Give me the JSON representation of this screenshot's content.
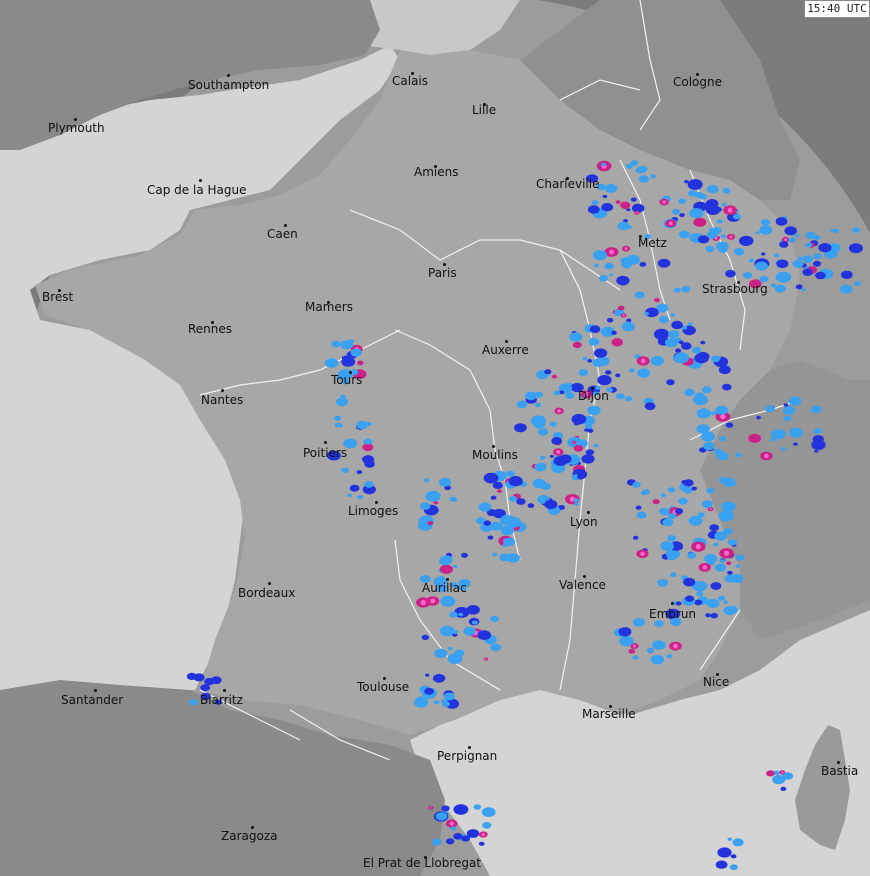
{
  "timestamp": "15:40 UTC",
  "cities": [
    {
      "name": "Southampton"
    },
    {
      "name": "Plymouth"
    },
    {
      "name": "Calais"
    },
    {
      "name": "Lille"
    },
    {
      "name": "Cologne"
    },
    {
      "name": "Amiens"
    },
    {
      "name": "Charleville"
    },
    {
      "name": "Cap de la Hague"
    },
    {
      "name": "Caen"
    },
    {
      "name": "Metz"
    },
    {
      "name": "Paris"
    },
    {
      "name": "Brest"
    },
    {
      "name": "Strasbourg"
    },
    {
      "name": "Mamers"
    },
    {
      "name": "Rennes"
    },
    {
      "name": "Auxerre"
    },
    {
      "name": "Tours"
    },
    {
      "name": "Nantes"
    },
    {
      "name": "Dijon"
    },
    {
      "name": "Poitiers"
    },
    {
      "name": "Moulins"
    },
    {
      "name": "Limoges"
    },
    {
      "name": "Lyon"
    },
    {
      "name": "Aurillac"
    },
    {
      "name": "Valence"
    },
    {
      "name": "Bordeaux"
    },
    {
      "name": "Embrun"
    },
    {
      "name": "Nice"
    },
    {
      "name": "Toulouse"
    },
    {
      "name": "Santander"
    },
    {
      "name": "Biarritz"
    },
    {
      "name": "Marseille"
    },
    {
      "name": "Perpignan"
    },
    {
      "name": "Bastia"
    },
    {
      "name": "Zaragoza"
    },
    {
      "name": "El Prat de Llobregat"
    }
  ],
  "colors": {
    "sea": "#d4d4d4",
    "land_in_range": "#9c9c9c",
    "land_out_of_range": "#7c7c7c",
    "radar_light": "#3aa0f0",
    "radar_medium": "#2233dd",
    "radar_strong": "#cc2288",
    "radar_intense": "#ff66cc"
  },
  "icons": {
    "city_marker": "dot-icon"
  }
}
